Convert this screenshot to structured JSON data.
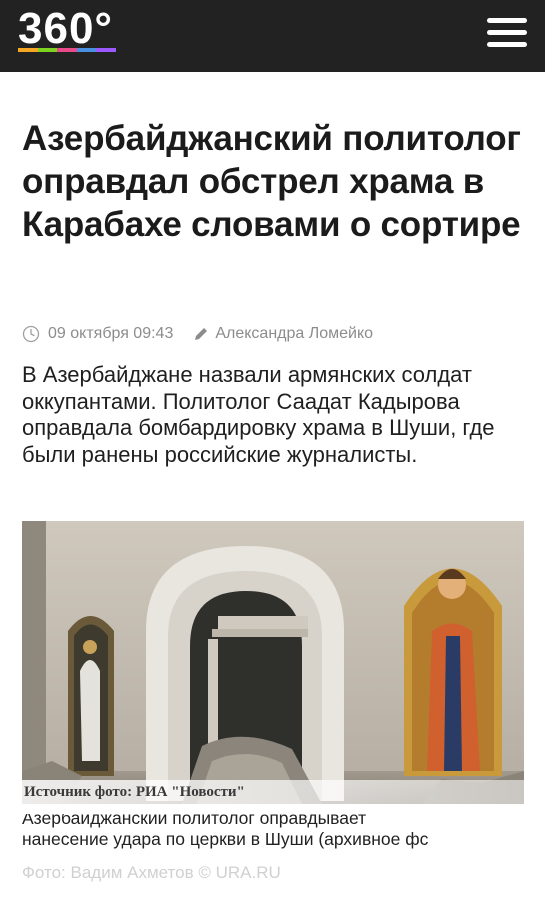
{
  "header": {
    "logo_text": "360°",
    "logo_stripe_colors": [
      "#f5a623",
      "#7ed321",
      "#e94b8a",
      "#4a90e2",
      "#9b59ff"
    ],
    "menu_icon": "hamburger-icon",
    "background": "#222222"
  },
  "article": {
    "title": "Азербайджанский политолог оправдал обстрел храма в Карабахе словами о сортире",
    "date": "09 октября 09:43",
    "date_icon": "clock-icon",
    "author": "Александра Ломейко",
    "author_icon": "pen-icon",
    "lead": "В Азербайджане назвали армянских солдат оккупантами. Политолог Саадат Кадырова оправдала бомбардировку храма в Шуши, где были ранены российские журналисты.",
    "image": {
      "alt_icon": "church-interior-photo",
      "credit": "Источник фото: РИА \"Новости\""
    },
    "caption_line1": "Азербайджанский политолог оправдывает",
    "caption_line2": "нанесение удара по церкви в Шуши (архивное фс",
    "photo_by": "Фото: Вадим Ахметов © URA.RU"
  }
}
